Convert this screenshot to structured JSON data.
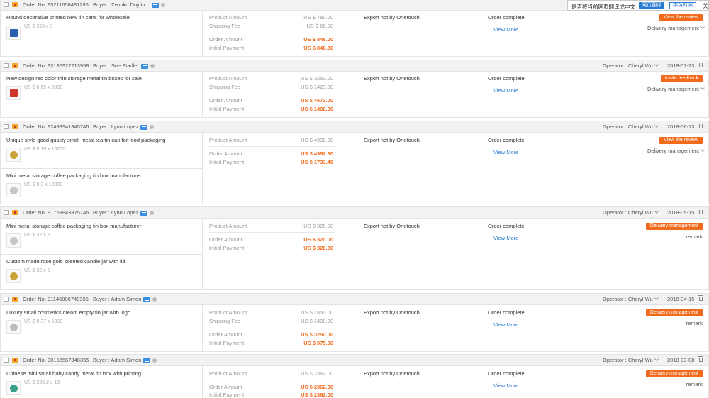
{
  "translate_bar": {
    "prompt": "是否将当前网页翻译成中文",
    "translate_button": "网页翻译",
    "compare_button": "中英对照",
    "close": "关"
  },
  "labels": {
    "product_amount": "Product Amount",
    "shipping_fee": "Shipping Fee",
    "order_amount": "Order Amount",
    "initial_payment": "Initial Payment",
    "export": "Export not by Onetouch",
    "status": "Order complete",
    "view_more": "View More",
    "delivery_management": "Delivery management",
    "remark": "remark"
  },
  "orders": [
    {
      "order_no": "Order No. 95211658481296",
      "buyer": "Buyer :  Zvonko Dojcin...",
      "operator": "",
      "date": "",
      "products": [
        {
          "title": "Round decorative printed new tin cans for wholesale",
          "price_qty": "US $ 260 x 3",
          "thumb_color": "#2a5db0"
        }
      ],
      "product_amount": "US $ 780.00",
      "shipping_fee": "US $ 66.00",
      "order_amount": "US $ 846.00",
      "initial_payment": "US $ 846.00",
      "action_button": "View the review"
    },
    {
      "order_no": "Order No. 93136927213958",
      "buyer": "Buyer :  Sue Stadler",
      "operator": "Operator : Cheryl Wu",
      "date": "2018-07-23",
      "products": [
        {
          "title": "New design red color thin storage metal tin boxes for sale",
          "price_qty": "US $ 0.65 x 5000",
          "thumb_color": "#d0342c"
        }
      ],
      "product_amount": "US $ 3250.00",
      "shipping_fee": "US $ 1423.00",
      "order_amount": "US $ 4673.00",
      "initial_payment": "US $ 1402.00",
      "action_button": "Invite feedback"
    },
    {
      "order_no": "Order No. 92499941845746",
      "buyer": "Buyer :  Lynn Lopez",
      "operator": "Operator : Cheryl Wu",
      "date": "2018-06-13",
      "products": [
        {
          "title": "Unique style good quality small metal tea tin can for food packaging",
          "price_qty": "US $ 0.19 x 10200",
          "thumb_color": "#c9a43a"
        },
        {
          "title": "Mini metal storage coffee packaging tin box manufacturer",
          "price_qty": "US $ 0.3 x 10080",
          "thumb_color": "#c7c7c7"
        }
      ],
      "product_amount": "US $ 4992.60",
      "order_amount": "US $ 4992.60",
      "initial_payment": "US $ 1733.40",
      "action_button": "View the review"
    },
    {
      "order_no": "Order No. 91768843375746",
      "buyer": "Buyer :  Lynn Lopez",
      "operator": "Operator : Cheryl Wu",
      "date": "2018-05-15",
      "products": [
        {
          "title": "Mini metal storage coffee packaging tin box manufacturer",
          "price_qty": "US $ 32 x 5",
          "thumb_color": "#c7c7c7"
        },
        {
          "title": "Custom made rose gold scented candle jar with lid",
          "price_qty": "US $ 32 x 5",
          "thumb_color": "#c9a43a"
        }
      ],
      "product_amount": "US $ 320.00",
      "order_amount": "US $ 320.00",
      "initial_payment": "US $ 320.00",
      "action_button": "Delivery management"
    },
    {
      "order_no": "Order No. 91146006748355",
      "buyer": "Buyer :  Adam Simon",
      "operator": "Operator : Cheryl Wu",
      "date": "2018-04-15",
      "products": [
        {
          "title": "Luxury small cosmetics cream empty tin jar with logo",
          "price_qty": "US $ 0.37 x 5000",
          "thumb_color": "#bdbdbd"
        }
      ],
      "product_amount": "US $ 1850.00",
      "shipping_fee": "US $ 1400.00",
      "order_amount": "US $ 3250.00",
      "initial_payment": "US $ 975.00",
      "action_button": "Delivery management"
    },
    {
      "order_no": "Order No. 90155567348355",
      "buyer": "Buyer :  Adam Simon",
      "operator": "Operator : Cheryl Wu",
      "date": "2018-03-08",
      "products": [
        {
          "title": "Chinese mini small baby candy metal tin box with printing",
          "price_qty": "US $ 236.2 x 10",
          "thumb_color": "#3aa08a"
        }
      ],
      "product_amount": "US $ 2362.00",
      "order_amount": "US $ 2362.00",
      "initial_payment": "US $ 2362.00",
      "action_button": "Delivery management"
    }
  ]
}
